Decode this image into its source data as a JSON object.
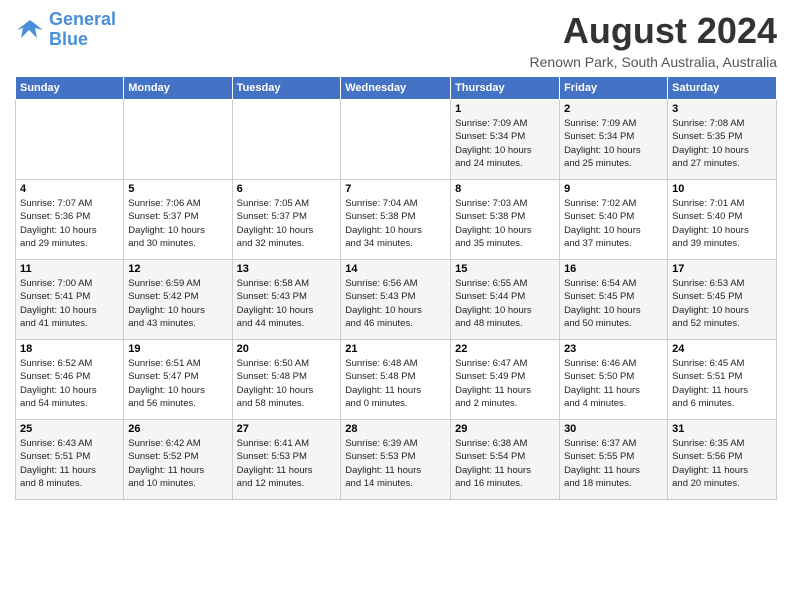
{
  "logo": {
    "line1": "General",
    "line2": "Blue"
  },
  "title": "August 2024",
  "location": "Renown Park, South Australia, Australia",
  "headers": [
    "Sunday",
    "Monday",
    "Tuesday",
    "Wednesday",
    "Thursday",
    "Friday",
    "Saturday"
  ],
  "weeks": [
    [
      {
        "num": "",
        "info": ""
      },
      {
        "num": "",
        "info": ""
      },
      {
        "num": "",
        "info": ""
      },
      {
        "num": "",
        "info": ""
      },
      {
        "num": "1",
        "info": "Sunrise: 7:09 AM\nSunset: 5:34 PM\nDaylight: 10 hours\nand 24 minutes."
      },
      {
        "num": "2",
        "info": "Sunrise: 7:09 AM\nSunset: 5:34 PM\nDaylight: 10 hours\nand 25 minutes."
      },
      {
        "num": "3",
        "info": "Sunrise: 7:08 AM\nSunset: 5:35 PM\nDaylight: 10 hours\nand 27 minutes."
      }
    ],
    [
      {
        "num": "4",
        "info": "Sunrise: 7:07 AM\nSunset: 5:36 PM\nDaylight: 10 hours\nand 29 minutes."
      },
      {
        "num": "5",
        "info": "Sunrise: 7:06 AM\nSunset: 5:37 PM\nDaylight: 10 hours\nand 30 minutes."
      },
      {
        "num": "6",
        "info": "Sunrise: 7:05 AM\nSunset: 5:37 PM\nDaylight: 10 hours\nand 32 minutes."
      },
      {
        "num": "7",
        "info": "Sunrise: 7:04 AM\nSunset: 5:38 PM\nDaylight: 10 hours\nand 34 minutes."
      },
      {
        "num": "8",
        "info": "Sunrise: 7:03 AM\nSunset: 5:38 PM\nDaylight: 10 hours\nand 35 minutes."
      },
      {
        "num": "9",
        "info": "Sunrise: 7:02 AM\nSunset: 5:40 PM\nDaylight: 10 hours\nand 37 minutes."
      },
      {
        "num": "10",
        "info": "Sunrise: 7:01 AM\nSunset: 5:40 PM\nDaylight: 10 hours\nand 39 minutes."
      }
    ],
    [
      {
        "num": "11",
        "info": "Sunrise: 7:00 AM\nSunset: 5:41 PM\nDaylight: 10 hours\nand 41 minutes."
      },
      {
        "num": "12",
        "info": "Sunrise: 6:59 AM\nSunset: 5:42 PM\nDaylight: 10 hours\nand 43 minutes."
      },
      {
        "num": "13",
        "info": "Sunrise: 6:58 AM\nSunset: 5:43 PM\nDaylight: 10 hours\nand 44 minutes."
      },
      {
        "num": "14",
        "info": "Sunrise: 6:56 AM\nSunset: 5:43 PM\nDaylight: 10 hours\nand 46 minutes."
      },
      {
        "num": "15",
        "info": "Sunrise: 6:55 AM\nSunset: 5:44 PM\nDaylight: 10 hours\nand 48 minutes."
      },
      {
        "num": "16",
        "info": "Sunrise: 6:54 AM\nSunset: 5:45 PM\nDaylight: 10 hours\nand 50 minutes."
      },
      {
        "num": "17",
        "info": "Sunrise: 6:53 AM\nSunset: 5:45 PM\nDaylight: 10 hours\nand 52 minutes."
      }
    ],
    [
      {
        "num": "18",
        "info": "Sunrise: 6:52 AM\nSunset: 5:46 PM\nDaylight: 10 hours\nand 54 minutes."
      },
      {
        "num": "19",
        "info": "Sunrise: 6:51 AM\nSunset: 5:47 PM\nDaylight: 10 hours\nand 56 minutes."
      },
      {
        "num": "20",
        "info": "Sunrise: 6:50 AM\nSunset: 5:48 PM\nDaylight: 10 hours\nand 58 minutes."
      },
      {
        "num": "21",
        "info": "Sunrise: 6:48 AM\nSunset: 5:48 PM\nDaylight: 11 hours\nand 0 minutes."
      },
      {
        "num": "22",
        "info": "Sunrise: 6:47 AM\nSunset: 5:49 PM\nDaylight: 11 hours\nand 2 minutes."
      },
      {
        "num": "23",
        "info": "Sunrise: 6:46 AM\nSunset: 5:50 PM\nDaylight: 11 hours\nand 4 minutes."
      },
      {
        "num": "24",
        "info": "Sunrise: 6:45 AM\nSunset: 5:51 PM\nDaylight: 11 hours\nand 6 minutes."
      }
    ],
    [
      {
        "num": "25",
        "info": "Sunrise: 6:43 AM\nSunset: 5:51 PM\nDaylight: 11 hours\nand 8 minutes."
      },
      {
        "num": "26",
        "info": "Sunrise: 6:42 AM\nSunset: 5:52 PM\nDaylight: 11 hours\nand 10 minutes."
      },
      {
        "num": "27",
        "info": "Sunrise: 6:41 AM\nSunset: 5:53 PM\nDaylight: 11 hours\nand 12 minutes."
      },
      {
        "num": "28",
        "info": "Sunrise: 6:39 AM\nSunset: 5:53 PM\nDaylight: 11 hours\nand 14 minutes."
      },
      {
        "num": "29",
        "info": "Sunrise: 6:38 AM\nSunset: 5:54 PM\nDaylight: 11 hours\nand 16 minutes."
      },
      {
        "num": "30",
        "info": "Sunrise: 6:37 AM\nSunset: 5:55 PM\nDaylight: 11 hours\nand 18 minutes."
      },
      {
        "num": "31",
        "info": "Sunrise: 6:35 AM\nSunset: 5:56 PM\nDaylight: 11 hours\nand 20 minutes."
      }
    ]
  ]
}
